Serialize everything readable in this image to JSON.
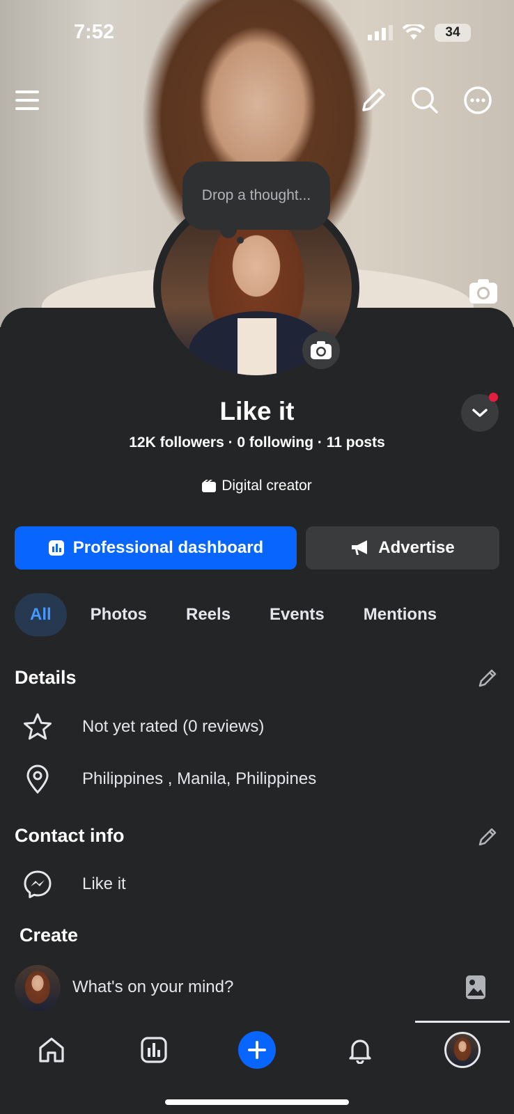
{
  "status_bar": {
    "time": "7:52",
    "battery": "34"
  },
  "composer": {
    "bubble_placeholder": "Drop a thought..."
  },
  "profile": {
    "name": "Like it",
    "stats": "12K followers · 0 following · 11 posts",
    "category": "Digital creator"
  },
  "actions": {
    "primary_label": "Professional dashboard",
    "secondary_label": "Advertise"
  },
  "tabs": [
    {
      "label": "All",
      "active": true
    },
    {
      "label": "Photos",
      "active": false
    },
    {
      "label": "Reels",
      "active": false
    },
    {
      "label": "Events",
      "active": false
    },
    {
      "label": "Mentions",
      "active": false
    }
  ],
  "details": {
    "title": "Details",
    "items": [
      {
        "icon": "star-icon",
        "text": "Not yet rated (0 reviews)"
      },
      {
        "icon": "location-pin-icon",
        "text": "Philippines , Manila, Philippines"
      }
    ]
  },
  "contact": {
    "title": "Contact info",
    "items": [
      {
        "icon": "messenger-icon",
        "text": "Like it"
      }
    ]
  },
  "create": {
    "title": "Create",
    "placeholder": "What's on your mind?"
  },
  "bottom_nav": [
    "home-icon",
    "dashboard-icon",
    "plus-icon",
    "bell-icon",
    "profile-avatar"
  ],
  "colors": {
    "accent": "#0866ff",
    "background": "#242526",
    "secondary_button": "#3a3b3c",
    "active_tab_bg": "#263951",
    "active_tab_text": "#4599ff",
    "notification": "#e41e3f"
  }
}
